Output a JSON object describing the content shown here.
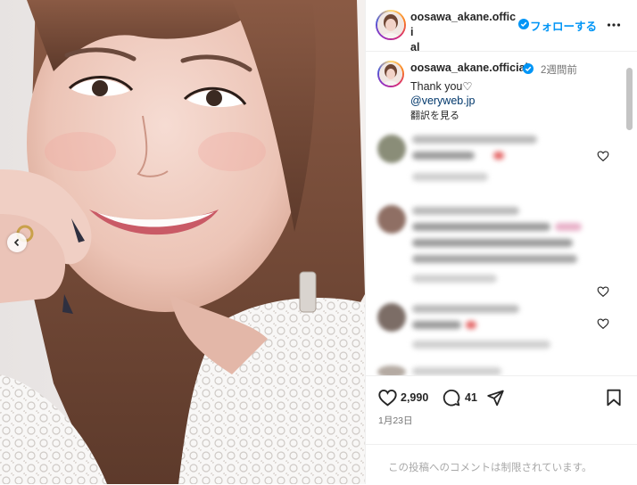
{
  "post": {
    "username": "oosawa_akane.official",
    "username_line1": "oosawa_akane.offici",
    "username_line2": "al",
    "follow_label": "フォローする",
    "more_icon": "more-dots-icon"
  },
  "caption": {
    "username": "oosawa_akane.official",
    "time": "2週間前",
    "text": "Thank you♡",
    "link": "@veryweb.jp",
    "translate": "翻訳を見る"
  },
  "comments": [
    {
      "blurred": true
    },
    {
      "blurred": true
    },
    {
      "blurred": true
    }
  ],
  "actions": {
    "likes": "2,990",
    "comments": "41",
    "date": "1月23日"
  },
  "footer": {
    "notice": "この投稿へのコメントは制限されています。"
  },
  "colors": {
    "accent": "#0095f6",
    "link": "#00376b",
    "muted": "#737373"
  }
}
